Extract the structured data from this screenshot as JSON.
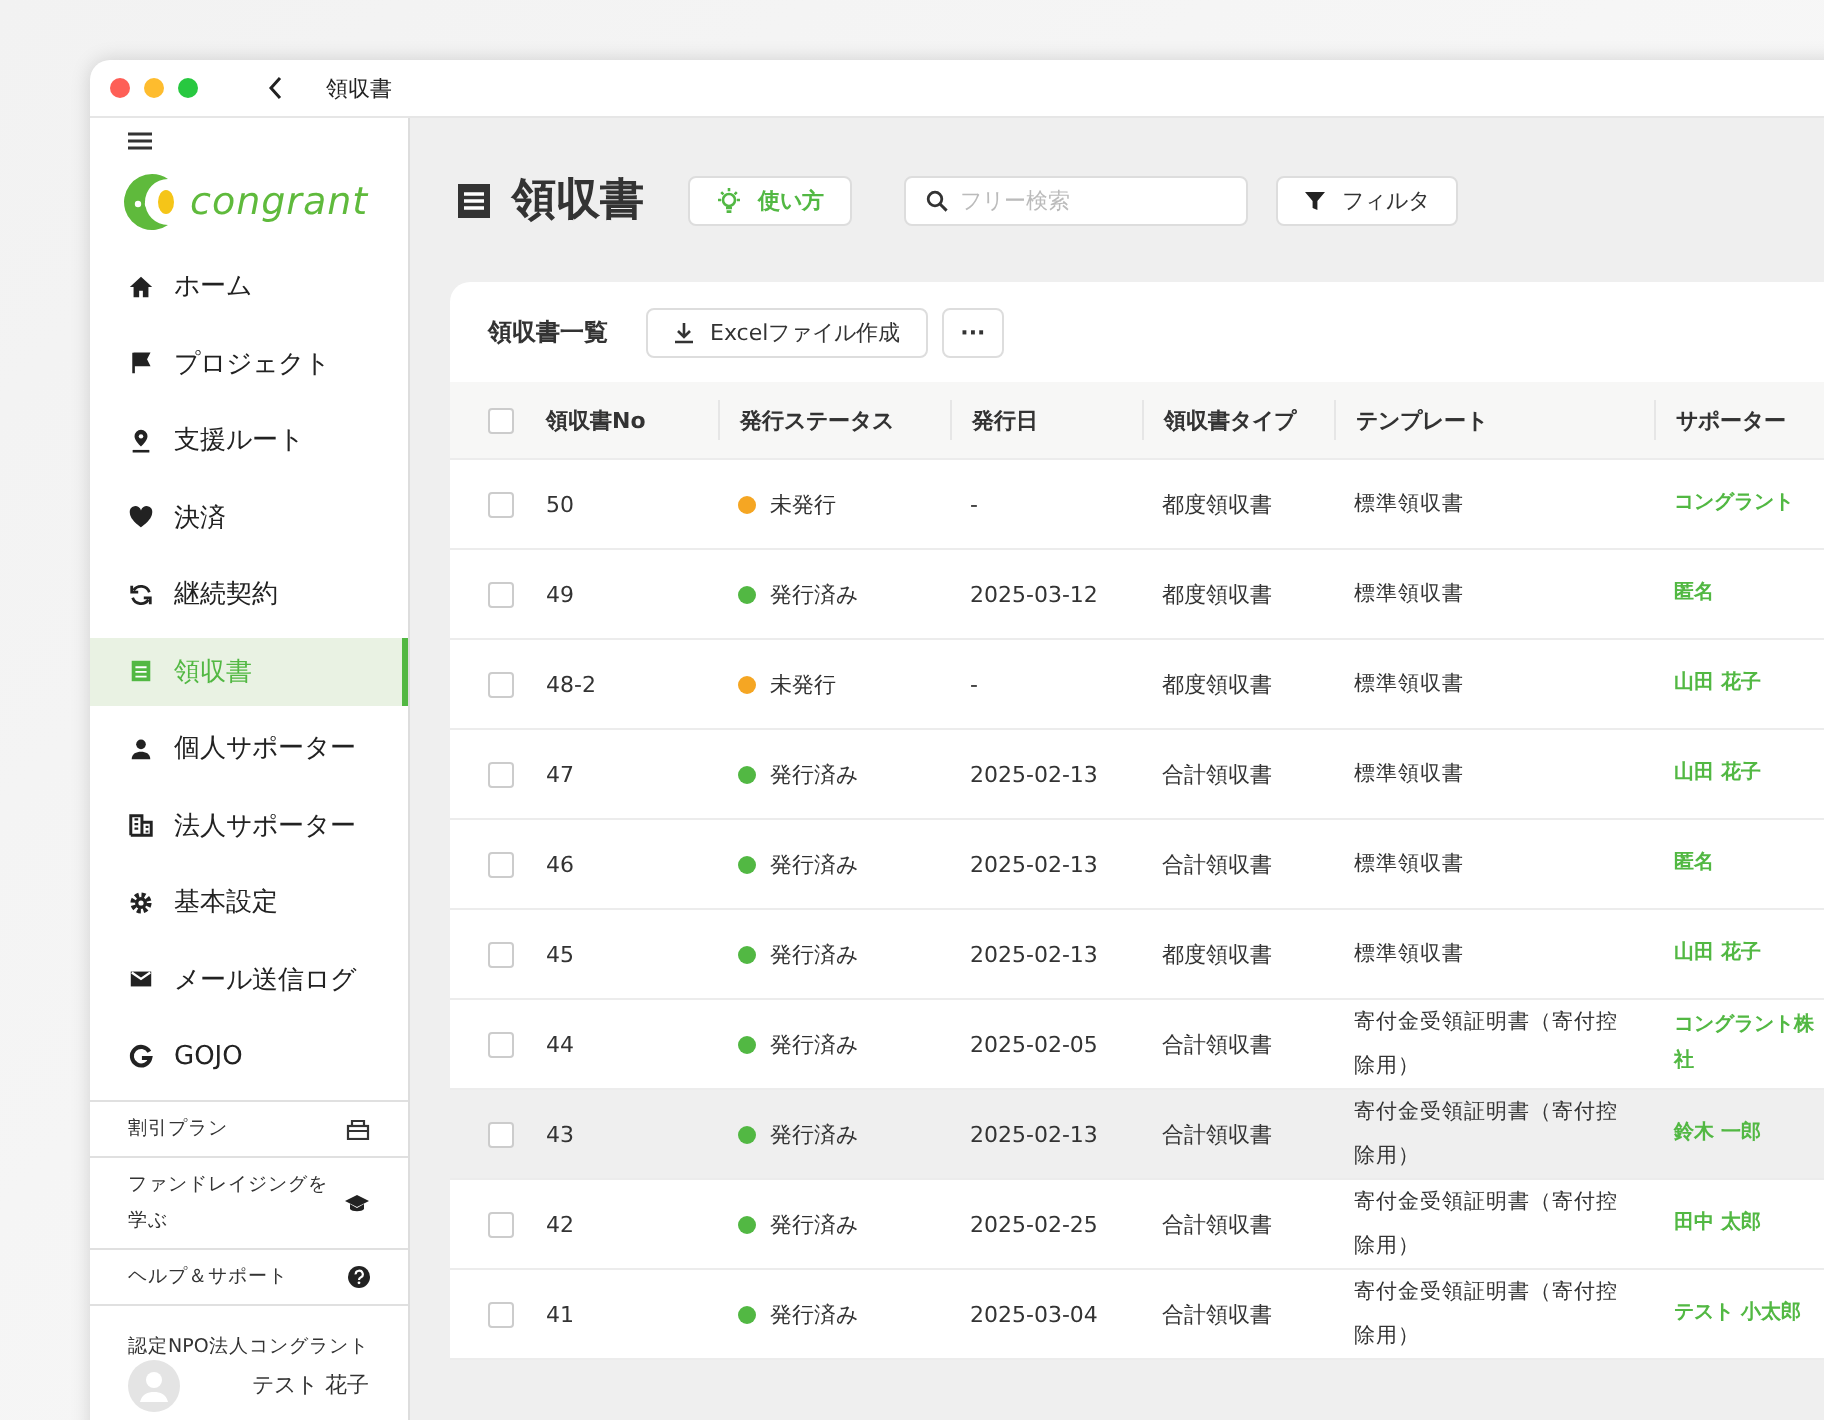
{
  "window": {
    "title": "領収書"
  },
  "sidebar": {
    "items": [
      {
        "label": "ホーム",
        "selected": false
      },
      {
        "label": "プロジェクト",
        "selected": false
      },
      {
        "label": "支援ルート",
        "selected": false
      },
      {
        "label": "決済",
        "selected": false
      },
      {
        "label": "継続契約",
        "selected": false
      },
      {
        "label": "領収書",
        "selected": true
      },
      {
        "label": "個人サポーター",
        "selected": false
      },
      {
        "label": "法人サポーター",
        "selected": false
      },
      {
        "label": "基本設定",
        "selected": false
      },
      {
        "label": "メール送信ログ",
        "selected": false
      },
      {
        "label": "GOJO",
        "selected": false
      }
    ],
    "links": [
      {
        "label": "割引プラン"
      },
      {
        "label": "ファンドレイジングを学ぶ"
      },
      {
        "label": "ヘルプ＆サポート"
      }
    ],
    "logo": "congrant",
    "organization": "認定NPO法人コングラント",
    "user": "テスト 花子"
  },
  "page": {
    "title": "領収書",
    "help_button": "使い方",
    "search": {
      "placeholder": "フリー検索"
    },
    "filter_button": "フィルタ"
  },
  "card": {
    "title": "領収書一覧",
    "export_button": "Excelファイル作成",
    "more_button": "···"
  },
  "table": {
    "all_checked": false,
    "columns": [
      "領収書No",
      "発行ステータス",
      "発行日",
      "領収書タイプ",
      "テンプレート",
      "サポーター"
    ],
    "rows": [
      {
        "checked": false,
        "highlighted": false,
        "no": "50",
        "status": "未発行",
        "color": "#f5a623",
        "date": "-",
        "type": "都度領収書",
        "template": "標準領収書",
        "supporter": "コングラント"
      },
      {
        "checked": false,
        "highlighted": false,
        "no": "49",
        "status": "発行済み",
        "color": "#52b843",
        "date": "2025-03-12",
        "type": "都度領収書",
        "template": "標準領収書",
        "supporter": "匿名"
      },
      {
        "checked": false,
        "highlighted": false,
        "no": "48-2",
        "status": "未発行",
        "color": "#f5a623",
        "date": "-",
        "type": "都度領収書",
        "template": "標準領収書",
        "supporter": "山田 花子"
      },
      {
        "checked": false,
        "highlighted": false,
        "no": "47",
        "status": "発行済み",
        "color": "#52b843",
        "date": "2025-02-13",
        "type": "合計領収書",
        "template": "標準領収書",
        "supporter": "山田 花子"
      },
      {
        "checked": false,
        "highlighted": false,
        "no": "46",
        "status": "発行済み",
        "color": "#52b843",
        "date": "2025-02-13",
        "type": "合計領収書",
        "template": "標準領収書",
        "supporter": "匿名"
      },
      {
        "checked": false,
        "highlighted": false,
        "no": "45",
        "status": "発行済み",
        "color": "#52b843",
        "date": "2025-02-13",
        "type": "都度領収書",
        "template": "標準領収書",
        "supporter": "山田 花子"
      },
      {
        "checked": false,
        "highlighted": false,
        "no": "44",
        "status": "発行済み",
        "color": "#52b843",
        "date": "2025-02-05",
        "type": "合計領収書",
        "template": "寄付金受領証明書（寄付控除用）",
        "supporter": "コングラント株社"
      },
      {
        "checked": false,
        "highlighted": true,
        "no": "43",
        "status": "発行済み",
        "color": "#52b843",
        "date": "2025-02-13",
        "type": "合計領収書",
        "template": "寄付金受領証明書（寄付控除用）",
        "supporter": "鈴木 一郎"
      },
      {
        "checked": false,
        "highlighted": false,
        "no": "42",
        "status": "発行済み",
        "color": "#52b843",
        "date": "2025-02-25",
        "type": "合計領収書",
        "template": "寄付金受領証明書（寄付控除用）",
        "supporter": "田中 太郎"
      },
      {
        "checked": false,
        "highlighted": false,
        "no": "41",
        "status": "発行済み",
        "color": "#52b843",
        "date": "2025-03-04",
        "type": "合計領収書",
        "template": "寄付金受領証明書（寄付控除用）",
        "supporter": "テスト 小太郎"
      }
    ]
  }
}
